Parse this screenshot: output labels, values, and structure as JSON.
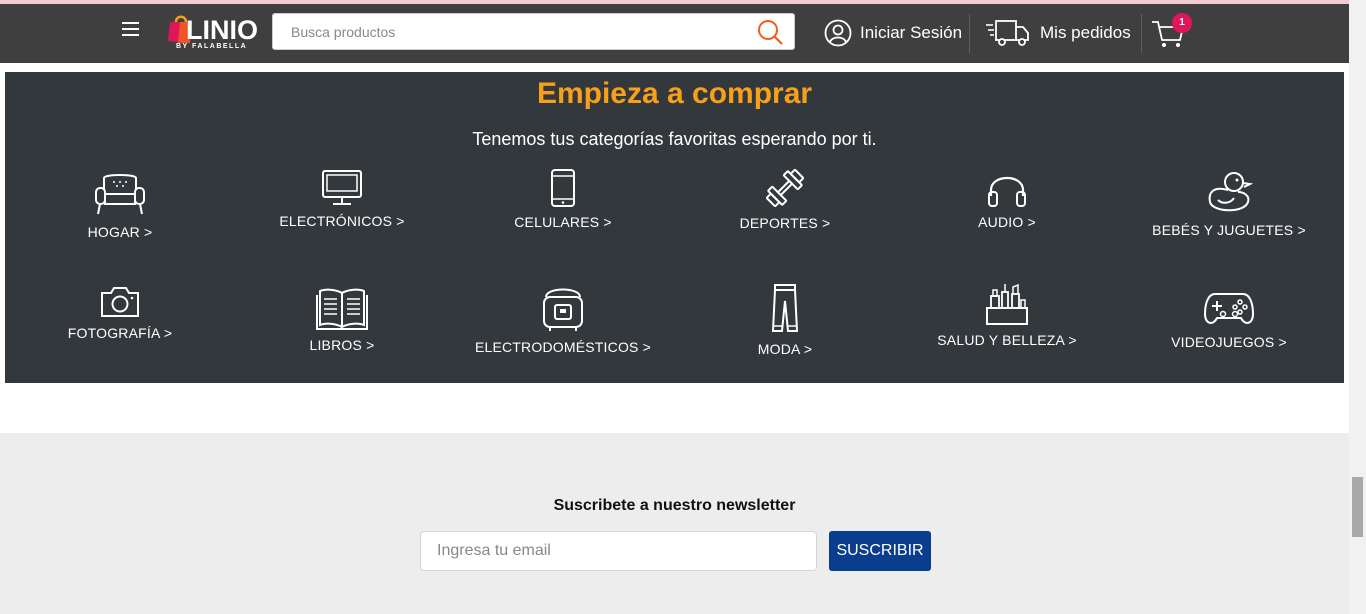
{
  "header": {
    "logo_text": "LINIO",
    "logo_sub": "BY FALABELLA",
    "search_placeholder": "Busca productos",
    "login_label": "Iniciar Sesión",
    "orders_label": "Mis pedidos",
    "cart_count": "1"
  },
  "panel": {
    "title": "Empieza a comprar",
    "subtitle": "Tenemos tus categorías favoritas esperando por ti.",
    "categories": [
      {
        "label": "HOGAR >",
        "icon": "sofa-icon"
      },
      {
        "label": "ELECTRÓNICOS >",
        "icon": "monitor-icon"
      },
      {
        "label": "CELULARES >",
        "icon": "smartphone-icon"
      },
      {
        "label": "DEPORTES >",
        "icon": "dumbbell-icon"
      },
      {
        "label": "AUDIO >",
        "icon": "headphones-icon"
      },
      {
        "label": "BEBÉS Y JUGUETES >",
        "icon": "rubber-duck-icon"
      },
      {
        "label": "FOTOGRAFÍA >",
        "icon": "camera-icon"
      },
      {
        "label": "LIBROS >",
        "icon": "book-icon"
      },
      {
        "label": "ELECTRODOMÉSTICOS >",
        "icon": "rice-cooker-icon"
      },
      {
        "label": "MODA >",
        "icon": "pants-icon"
      },
      {
        "label": "SALUD Y BELLEZA >",
        "icon": "cosmetics-icon"
      },
      {
        "label": "VIDEOJUEGOS >",
        "icon": "gamepad-icon"
      }
    ]
  },
  "newsletter": {
    "title": "Suscribete a nuestro newsletter",
    "email_placeholder": "Ingresa tu email",
    "button_label": "SUSCRIBIR"
  },
  "colors": {
    "header_bg": "#3f3f3f",
    "panel_bg": "#33383d",
    "title_orange": "#f7a01a",
    "button_blue": "#0b3d8f",
    "badge_pink": "#e0155a"
  }
}
